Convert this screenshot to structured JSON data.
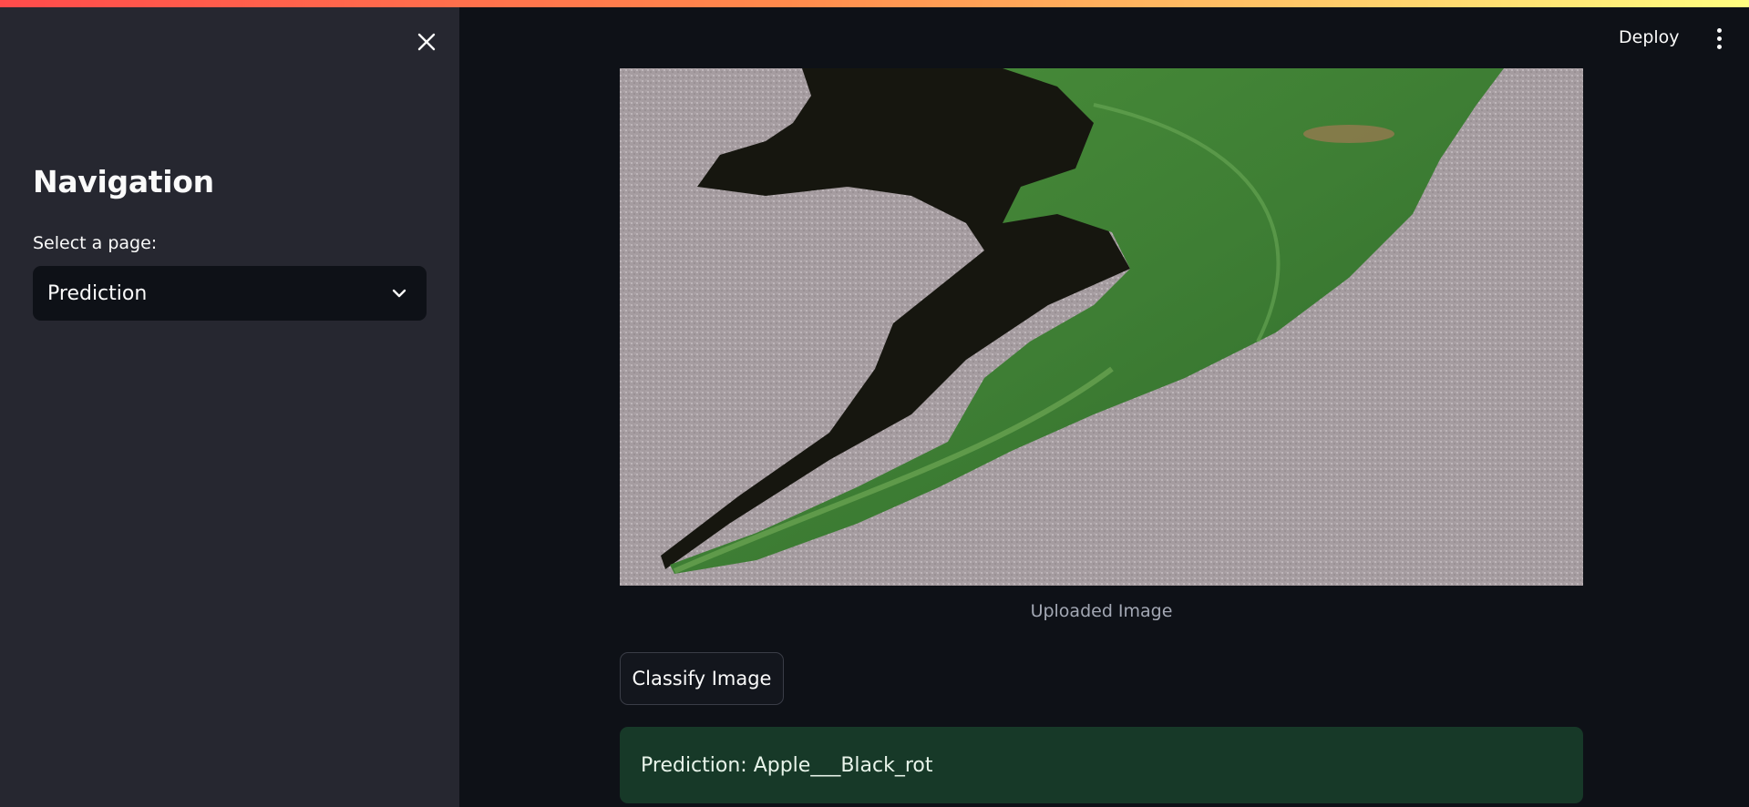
{
  "sidebar": {
    "title": "Navigation",
    "select_label": "Select a page:",
    "selected_page": "Prediction",
    "close_icon": "close-icon",
    "dropdown_icon": "chevron-down-icon"
  },
  "header": {
    "deploy_label": "Deploy",
    "menu_icon": "vertical-dots-icon"
  },
  "main": {
    "image_caption": "Uploaded Image",
    "classify_button_label": "Classify Image",
    "prediction_text": "Prediction: Apple___Black_rot"
  },
  "colors": {
    "background": "#0e1117",
    "sidebar": "#262730",
    "success_bg": "#173928",
    "accent_gradient_start": "#ff4b4b",
    "accent_gradient_end": "#fffd80"
  }
}
